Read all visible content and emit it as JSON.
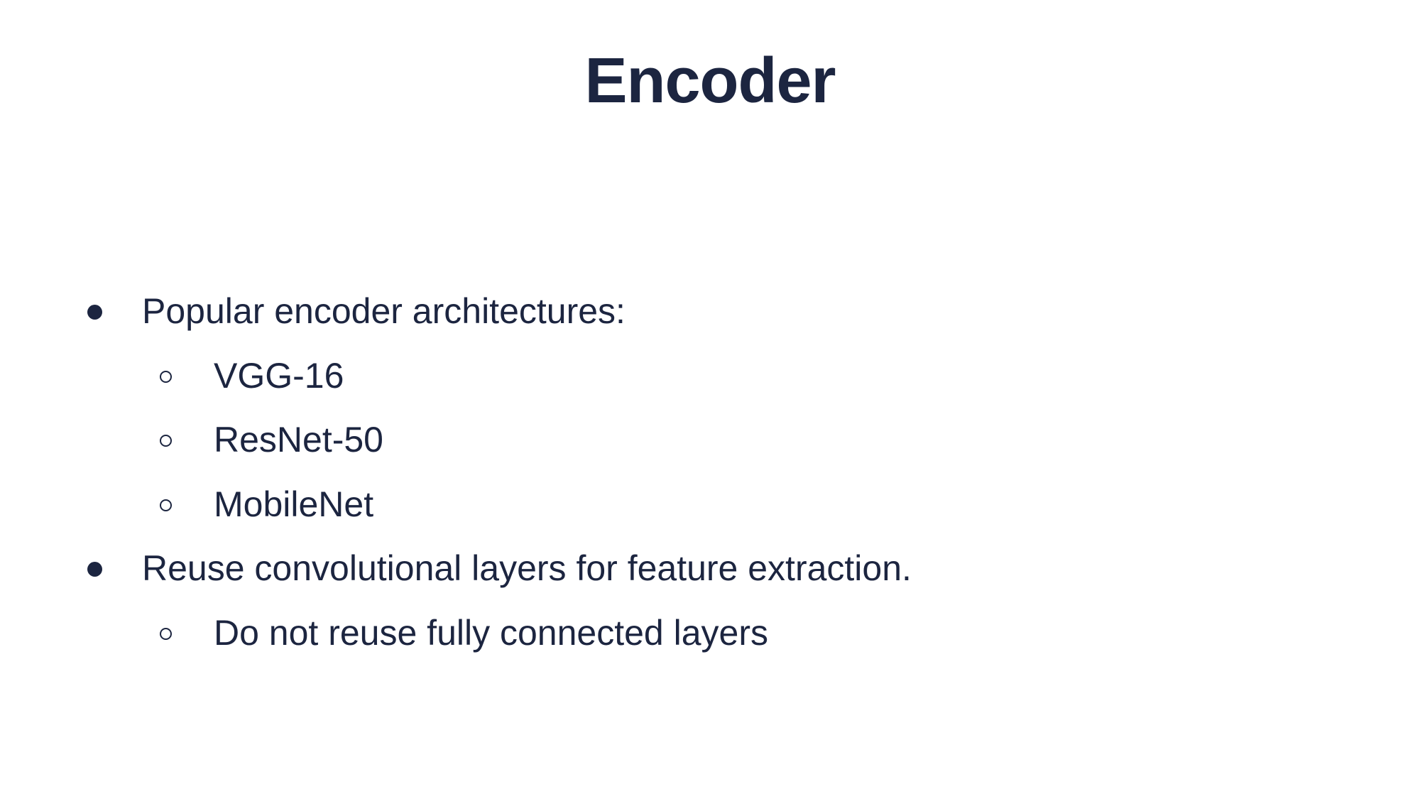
{
  "slide": {
    "title": "Encoder",
    "bullets": [
      {
        "text": "Popular encoder architectures:",
        "children": [
          "VGG-16",
          "ResNet-50",
          "MobileNet"
        ]
      },
      {
        "text": "Reuse convolutional layers for feature extraction.",
        "children": [
          "Do not reuse fully connected layers"
        ]
      }
    ]
  },
  "colors": {
    "text": "#1c2540",
    "background": "#ffffff"
  },
  "icons": {
    "level1_marker": "filled-circle-bullet-icon",
    "level2_marker": "hollow-circle-bullet-icon"
  }
}
